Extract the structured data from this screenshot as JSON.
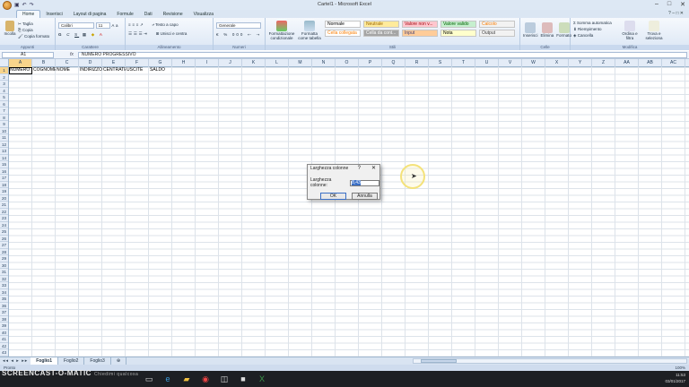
{
  "window": {
    "title": "Cartel1 - Microsoft Excel",
    "controls": [
      "–",
      "□",
      "✕"
    ]
  },
  "ribbon": {
    "tabs": [
      "Home",
      "Inserisci",
      "Layout di pagina",
      "Formule",
      "Dati",
      "Revisione",
      "Visualizza"
    ],
    "active_tab": "Home",
    "clipboard": {
      "label": "Appunti",
      "paste": "Incolla",
      "cut": "Taglia",
      "copy": "Copia",
      "format_painter": "Copia formato"
    },
    "font": {
      "label": "Carattere",
      "name": "Calibri",
      "size": "11"
    },
    "alignment": {
      "label": "Allineamento",
      "wrap": "Testo a capo",
      "merge": "Unisci e centra"
    },
    "number": {
      "label": "Numeri",
      "format": "Generale"
    },
    "styles": {
      "label": "Stili",
      "cond_format": "Formattazione condizionale",
      "as_table": "Formatta come tabella",
      "cells": [
        {
          "text": "Normale",
          "bg": "#ffffff",
          "fg": "#000000"
        },
        {
          "text": "Neutrale",
          "bg": "#ffeb9c",
          "fg": "#9c6500"
        },
        {
          "text": "Valore non v...",
          "bg": "#ffc7ce",
          "fg": "#9c0006"
        },
        {
          "text": "Valore valido",
          "bg": "#c6efce",
          "fg": "#006100"
        },
        {
          "text": "Calcolo",
          "bg": "#f2f2f2",
          "fg": "#fa7d00"
        },
        {
          "text": "Cella collegata",
          "bg": "#ffffff",
          "fg": "#fa7d00"
        },
        {
          "text": "Cella da cont...",
          "bg": "#a5a5a5",
          "fg": "#ffffff"
        },
        {
          "text": "Input",
          "bg": "#ffcc99",
          "fg": "#3f3f76"
        },
        {
          "text": "Nota",
          "bg": "#ffffcc",
          "fg": "#000000"
        },
        {
          "text": "Output",
          "bg": "#f2f2f2",
          "fg": "#3f3f3f"
        }
      ]
    },
    "cells_group": {
      "label": "Celle",
      "insert": "Inserisci",
      "delete": "Elimina",
      "format": "Formato"
    },
    "editing": {
      "label": "Modifica",
      "autosum": "Somma automatica",
      "fill": "Riempimento",
      "clear": "Cancella",
      "sort": "Ordina e filtra",
      "find": "Trova e seleziona"
    }
  },
  "formula_bar": {
    "cell_ref": "A1",
    "fx": "fx",
    "content": "NUMERO PROGRESSIVO"
  },
  "grid": {
    "columns": [
      "A",
      "B",
      "C",
      "D",
      "E",
      "F",
      "G",
      "H",
      "I",
      "J",
      "K",
      "L",
      "M",
      "N",
      "O",
      "P",
      "Q",
      "R",
      "S",
      "T",
      "U",
      "V",
      "W",
      "X",
      "Y",
      "Z",
      "AA",
      "AB",
      "AC"
    ],
    "rows": [
      "1",
      "2",
      "3",
      "4",
      "5",
      "6",
      "7",
      "8",
      "9",
      "10",
      "11",
      "12",
      "13",
      "14",
      "15",
      "16",
      "17",
      "18",
      "19",
      "20",
      "21",
      "22",
      "23",
      "24",
      "25",
      "26",
      "27",
      "28",
      "29",
      "30",
      "31",
      "32",
      "33",
      "34",
      "35",
      "36",
      "37",
      "38",
      "39",
      "40",
      "41",
      "42",
      "43"
    ],
    "row1": [
      "NUMERO",
      "COGNOME",
      "NOME",
      "INDIRIZZO",
      "CENTRATE",
      "USCITE",
      "SALDO"
    ],
    "selected_col": "A",
    "selected_row": "1"
  },
  "dialog": {
    "title": "Larghezza colonne",
    "help": "?",
    "close": "✕",
    "label": "Larghezza colonne:",
    "value": "8,43",
    "ok": "OK",
    "cancel": "Annulla"
  },
  "sheets": {
    "tabs": [
      "Foglio1",
      "Foglio2",
      "Foglio3"
    ],
    "active": "Foglio1",
    "nav": "◂◂ ◂ ▸ ▸▸"
  },
  "status": {
    "ready": "Pronto",
    "zoom": "100%"
  },
  "watermark": {
    "text": "SCREENCAST-O-MATIC",
    "search_hint": "Chiedimi qualcosa"
  },
  "taskbar": {
    "time": "11:53",
    "date": "03/01/2017"
  }
}
